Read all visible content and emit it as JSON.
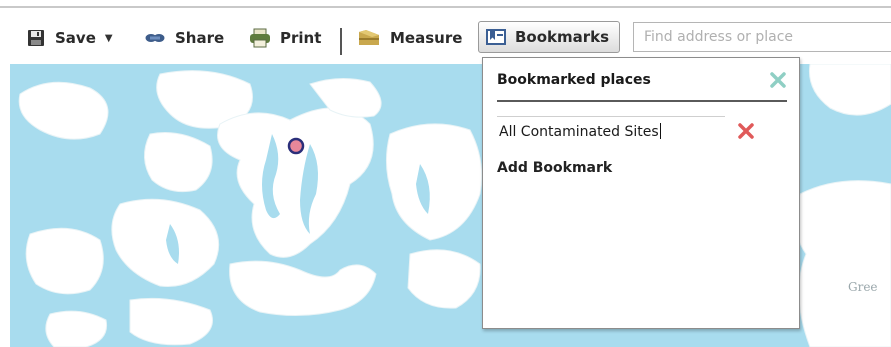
{
  "toolbar": {
    "save_label": "Save",
    "share_label": "Share",
    "print_label": "Print",
    "measure_label": "Measure",
    "bookmarks_label": "Bookmarks",
    "save_icon": "save-icon",
    "share_icon": "share-icon",
    "print_icon": "printer-icon",
    "measure_icon": "ruler-icon",
    "bookmarks_icon": "bookmark-icon"
  },
  "search": {
    "placeholder": "Find address or place",
    "value": ""
  },
  "bookmarks_panel": {
    "title": "Bookmarked places",
    "items": [
      {
        "label": "All Contaminated Sites"
      }
    ],
    "add_label": "Add Bookmark"
  },
  "map": {
    "label": "Gree",
    "water_color": "#a8dcee",
    "land_color": "#ffffff",
    "marker_fill": "#e9879a",
    "marker_stroke": "#2b2f7a"
  },
  "colors": {
    "close_icon": "#8fcfc4",
    "delete_icon": "#e05a5a"
  }
}
